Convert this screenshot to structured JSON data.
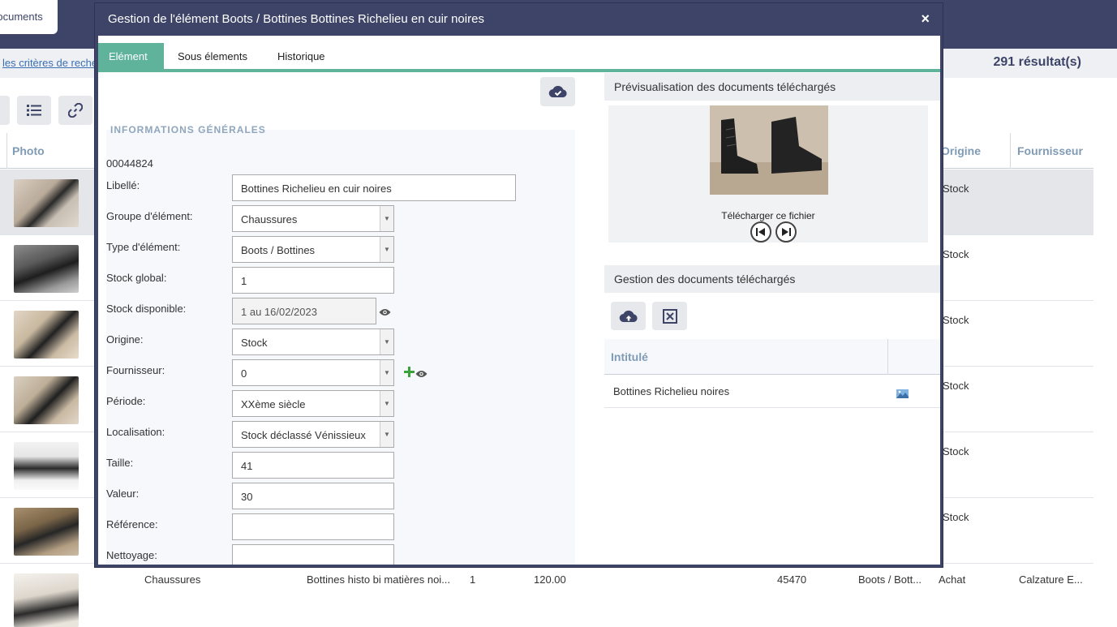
{
  "background": {
    "active_tab": "Documents",
    "criteria_link": "les critères de recherche",
    "result_count": "291 résultat(s)",
    "columns": {
      "photo": "Photo",
      "origine": "Origine",
      "fournisseur": "Fournisseur"
    },
    "rows": [
      {
        "origine": "Stock"
      },
      {
        "origine": "Stock"
      },
      {
        "origine": "Stock"
      },
      {
        "origine": "Stock"
      },
      {
        "origine": "Stock"
      },
      {
        "origine": "Stock"
      },
      {
        "groupe": "Chaussures",
        "libelle": "Bottines histo bi matières noi...",
        "stock": "1",
        "valeur": "120.00",
        "id": "45470",
        "type": "Boots / Bott...",
        "origine": "Achat",
        "fournisseur": "Calzature E..."
      }
    ]
  },
  "modal": {
    "title": "Gestion de l'élément Boots / Bottines Bottines Richelieu en cuir noires",
    "close_glyph": "×",
    "tabs": [
      "Elément",
      "Sous élements",
      "Historique"
    ],
    "section_title": "INFORMATIONS GÉNÉRALES",
    "element_id": "00044824",
    "fields": {
      "libelle": {
        "label": "Libellé:",
        "value": "Bottines Richelieu en cuir noires"
      },
      "groupe": {
        "label": "Groupe d'élément:",
        "value": "Chaussures"
      },
      "type": {
        "label": "Type d'élément:",
        "value": "Boots / Bottines"
      },
      "stock_global": {
        "label": "Stock global:",
        "value": "1"
      },
      "stock_dispo": {
        "label": "Stock disponible:",
        "value": "1 au 16/02/2023"
      },
      "origine": {
        "label": "Origine:",
        "value": "Stock"
      },
      "fournisseur": {
        "label": "Fournisseur:",
        "value": "0"
      },
      "periode": {
        "label": "Période:",
        "value": "XXème siècle"
      },
      "localisation": {
        "label": "Localisation:",
        "value": "Stock déclassé Vénissieux"
      },
      "taille": {
        "label": "Taille:",
        "value": "41"
      },
      "valeur": {
        "label": "Valeur:",
        "value": "30"
      },
      "reference": {
        "label": "Référence:",
        "value": ""
      },
      "nettoyage": {
        "label": "Nettoyage:",
        "value": ""
      }
    },
    "preview": {
      "title": "Prévisualisation des documents téléchargés",
      "download_link": "Télécharger ce fichier"
    },
    "docs": {
      "title": "Gestion des documents téléchargés",
      "column_intitule": "Intitulé",
      "rows": [
        {
          "intitule": "Bottines Richelieu noires"
        }
      ]
    }
  },
  "colors": {
    "header": "#3d4468",
    "accent": "#5fb39a",
    "column_header_text": "#7f9bb5"
  }
}
